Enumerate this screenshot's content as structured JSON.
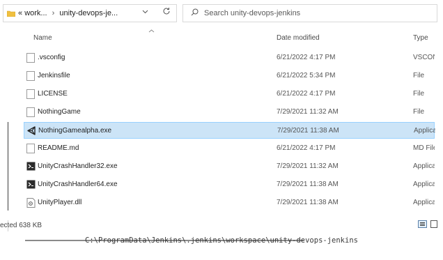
{
  "address_bar": {
    "breadcrumb_overflow": "«",
    "crumbs": [
      "work...",
      "unity-devops-je..."
    ],
    "separator": "›",
    "dropdown_icon": "chevron-down-icon",
    "refresh_icon": "refresh-icon"
  },
  "search": {
    "placeholder": "Search unity-devops-jenkins",
    "icon": "search-icon"
  },
  "columns": {
    "name": "Name",
    "date": "Date modified",
    "type": "Type"
  },
  "files": [
    {
      "name": ".vsconfig",
      "date": "6/21/2022 4:17 PM",
      "type": "VSCON",
      "icon": "file-icon"
    },
    {
      "name": "Jenkinsfile",
      "date": "6/21/2022 5:34 PM",
      "type": "File",
      "icon": "file-icon"
    },
    {
      "name": "LICENSE",
      "date": "6/21/2022 4:17 PM",
      "type": "File",
      "icon": "file-icon"
    },
    {
      "name": "NothingGame",
      "date": "7/29/2021 11:32 AM",
      "type": "File",
      "icon": "file-icon"
    },
    {
      "name": "NothingGamealpha.exe",
      "date": "7/29/2021 11:38 AM",
      "type": "Applica",
      "icon": "unity-app-icon",
      "selected": true
    },
    {
      "name": "README.md",
      "date": "6/21/2022 4:17 PM",
      "type": "MD File",
      "icon": "file-icon"
    },
    {
      "name": "UnityCrashHandler32.exe",
      "date": "7/29/2021 11:32 AM",
      "type": "Applica",
      "icon": "exe-icon"
    },
    {
      "name": "UnityCrashHandler64.exe",
      "date": "7/29/2021 11:38 AM",
      "type": "Applica",
      "icon": "exe-icon"
    },
    {
      "name": "UnityPlayer.dll",
      "date": "7/29/2021 11:38 AM",
      "type": "Applica",
      "icon": "dll-icon"
    }
  ],
  "status": {
    "text": "ected  638 KB"
  },
  "caption": "C:\\ProgramData\\Jenkins\\.jenkins\\workspace\\unity-devops-jenkins",
  "colors": {
    "selection_bg": "#cce4f7",
    "selection_border": "#99d1ff",
    "folder": "#f0c040"
  }
}
